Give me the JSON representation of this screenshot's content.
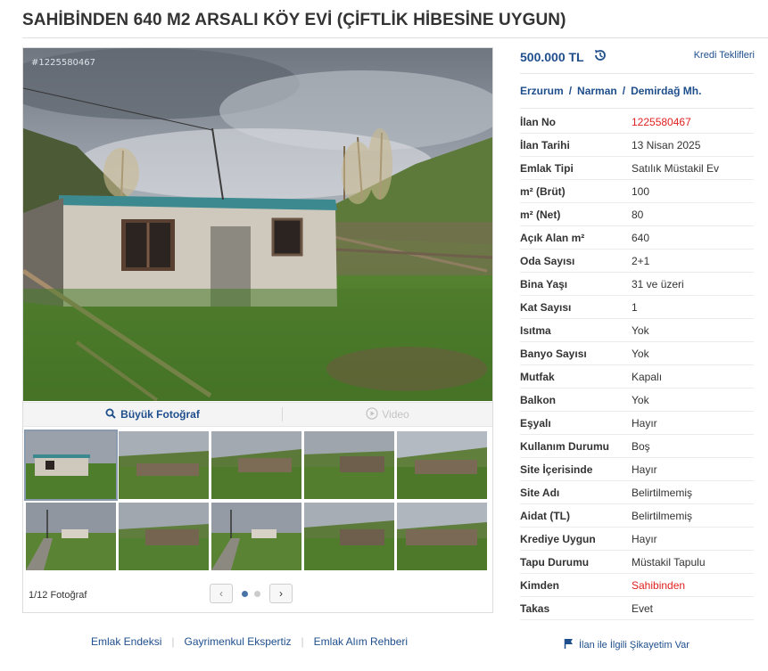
{
  "listing": {
    "title": "SAHİBİNDEN 640 M2 ARSALI KÖY EVİ (ÇİFTLİK HİBESİNE UYGUN)",
    "photo_id": "#1225580467",
    "price": "500.000 TL",
    "credit_link": "Kredi Teklifleri"
  },
  "location": {
    "city": "Erzurum",
    "district": "Narman",
    "neighborhood": "Demirdağ Mh.",
    "separator": "/"
  },
  "gallery": {
    "big_photo_label": "Büyük Fotoğraf",
    "video_label": "Video",
    "photo_count": "1/12 Fotoğraf",
    "prev_glyph": "‹",
    "next_glyph": "›",
    "pages": 2,
    "current_page": 1
  },
  "details": [
    {
      "key": "İlan No",
      "value": "1225580467",
      "color": "#e02020"
    },
    {
      "key": "İlan Tarihi",
      "value": "13 Nisan 2025"
    },
    {
      "key": "Emlak Tipi",
      "value": "Satılık Müstakil Ev"
    },
    {
      "key": "m² (Brüt)",
      "value": "100"
    },
    {
      "key": "m² (Net)",
      "value": "80"
    },
    {
      "key": "Açık Alan m²",
      "value": "640"
    },
    {
      "key": "Oda Sayısı",
      "value": "2+1"
    },
    {
      "key": "Bina Yaşı",
      "value": "31 ve üzeri"
    },
    {
      "key": "Kat Sayısı",
      "value": "1"
    },
    {
      "key": "Isıtma",
      "value": "Yok"
    },
    {
      "key": "Banyo Sayısı",
      "value": "Yok"
    },
    {
      "key": "Mutfak",
      "value": "Kapalı"
    },
    {
      "key": "Balkon",
      "value": "Yok"
    },
    {
      "key": "Eşyalı",
      "value": "Hayır"
    },
    {
      "key": "Kullanım Durumu",
      "value": "Boş"
    },
    {
      "key": "Site İçerisinde",
      "value": "Hayır"
    },
    {
      "key": "Site Adı",
      "value": "Belirtilmemiş"
    },
    {
      "key": "Aidat (TL)",
      "value": "Belirtilmemiş"
    },
    {
      "key": "Krediye Uygun",
      "value": "Hayır"
    },
    {
      "key": "Tapu Durumu",
      "value": "Müstakil Tapulu"
    },
    {
      "key": "Kimden",
      "value": "Sahibinden",
      "color": "#e02020"
    },
    {
      "key": "Takas",
      "value": "Evet"
    }
  ],
  "footer": {
    "links": [
      "Emlak Endeksi",
      "Gayrimenkul Ekspertiz",
      "Emlak Alım Rehberi"
    ],
    "complaint": "İlan ile İlgili Şikayetim Var"
  },
  "colors": {
    "accent": "#1e4e8c",
    "red": "#e02020",
    "border": "#dcdcdc"
  },
  "icons": {
    "price_history": "history-icon",
    "big_photo": "search-icon",
    "video": "play-icon",
    "complaint": "flag-icon"
  }
}
